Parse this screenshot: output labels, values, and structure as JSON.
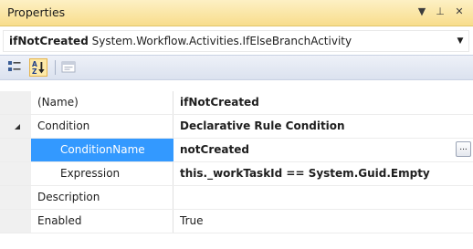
{
  "window": {
    "title": "Properties",
    "dropdown_glyph": "▼",
    "pin_glyph": "⊥",
    "close_glyph": "✕"
  },
  "selector": {
    "object_name": "ifNotCreated",
    "object_type": "System.Workflow.Activities.IfElseBranchActivity",
    "arrow_glyph": "▼"
  },
  "toolbar": {
    "buttons": [
      {
        "name": "Categorized",
        "icon": "categorized-icon",
        "active": false
      },
      {
        "name": "Alphabetical",
        "icon": "alphabetical-icon",
        "active": true
      },
      {
        "name": "Property Pages",
        "icon": "property-pages-icon",
        "active": false,
        "disabled": true
      }
    ]
  },
  "grid": {
    "rows": [
      {
        "name": "(Name)",
        "value": "ifNotCreated",
        "bold": true
      },
      {
        "name": "Condition",
        "value": "Declarative Rule Condition",
        "bold": true,
        "expanded": true
      },
      {
        "name": "ConditionName",
        "value": "notCreated",
        "bold": true,
        "selected": true,
        "child": true,
        "button": "..."
      },
      {
        "name": "Expression",
        "value": "this._workTaskId == System.Guid.Empty",
        "bold": true,
        "child": true
      },
      {
        "name": "Description",
        "value": "",
        "bold": false
      },
      {
        "name": "Enabled",
        "value": "True",
        "bold": false
      }
    ]
  },
  "colors": {
    "title_gradient_top": "#fdf0c4",
    "title_gradient_bottom": "#f8dd8c",
    "selection": "#3399ff",
    "toolbar_active": "#fce9a8"
  }
}
